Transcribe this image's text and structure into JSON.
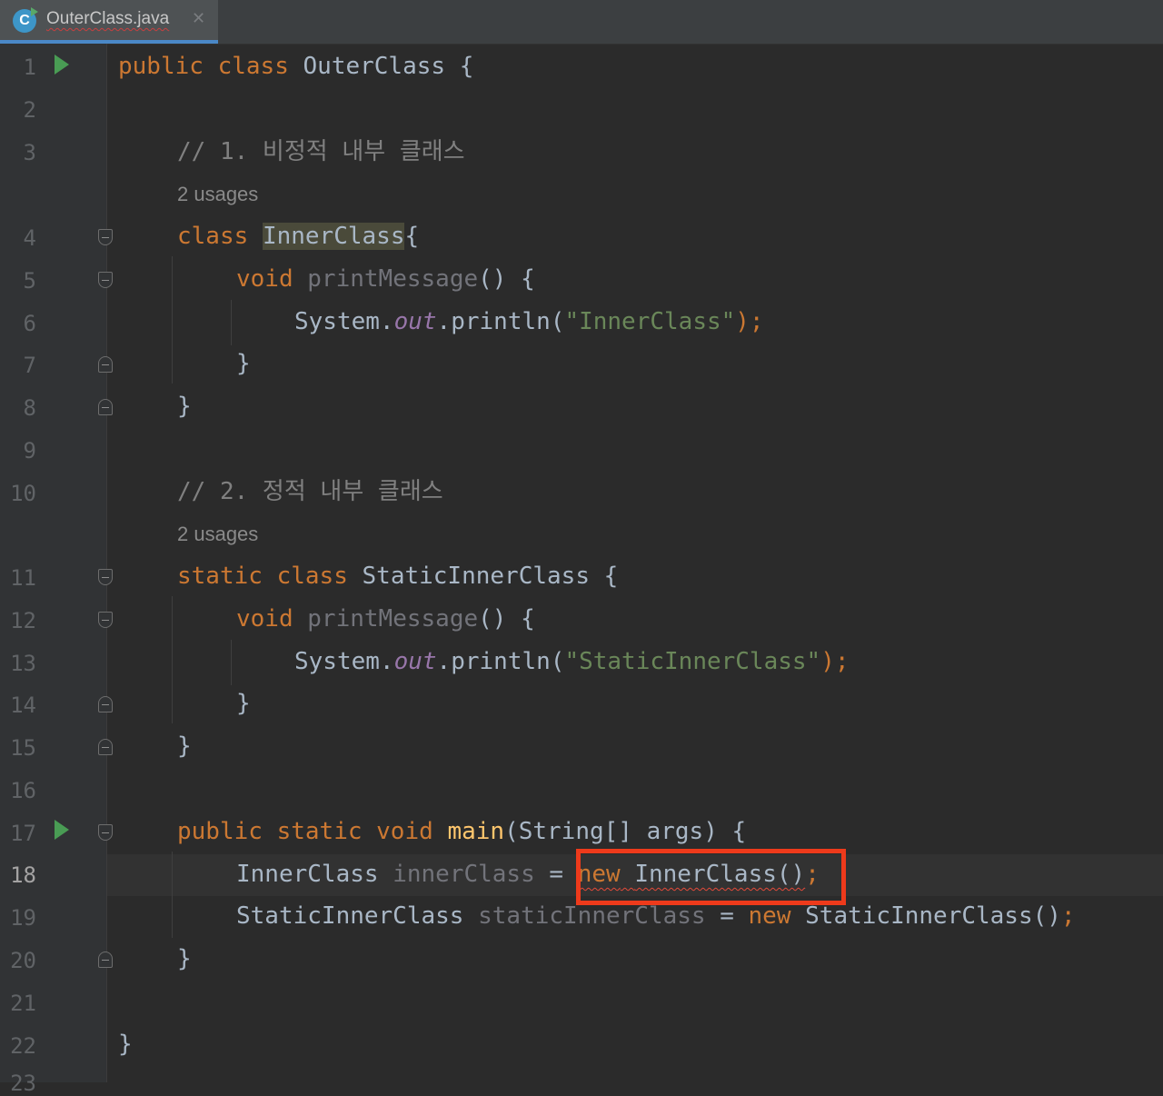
{
  "tab": {
    "file_name": "OuterClass.java",
    "icon_letter": "C",
    "close_glyph": "✕"
  },
  "gutter": {
    "line_numbers": [
      "1",
      "2",
      "3",
      "4",
      "5",
      "6",
      "7",
      "8",
      "9",
      "10",
      "11",
      "12",
      "13",
      "14",
      "15",
      "16",
      "17",
      "18",
      "19",
      "20",
      "21",
      "22",
      "23"
    ],
    "current_line": "18"
  },
  "code": {
    "l1": {
      "kw1": "public",
      "kw2": "class",
      "name": "OuterClass",
      "brace": "{"
    },
    "l3": "// 1. 비정적 내부 클래스",
    "hint1": "2 usages",
    "l4": {
      "kw": "class",
      "name": "InnerClass",
      "brace": "{"
    },
    "l5": {
      "kw": "void",
      "method": "printMessage",
      "rest": "() {"
    },
    "l6": {
      "obj": "System.",
      "field": "out",
      "call": ".println(",
      "str": "\"InnerClass\"",
      "end": ");"
    },
    "l7": "}",
    "l8": "}",
    "l10": "// 2. 정적 내부 클래스",
    "hint2": "2 usages",
    "l11": {
      "kw1": "static",
      "kw2": "class",
      "name": "StaticInnerClass",
      "brace": "{"
    },
    "l12": {
      "kw": "void",
      "method": "printMessage",
      "rest": "() {"
    },
    "l13": {
      "obj": "System.",
      "field": "out",
      "call": ".println(",
      "str": "\"StaticInnerClass\"",
      "end": ");"
    },
    "l14": "}",
    "l15": "}",
    "l17": {
      "kw1": "public",
      "kw2": "static",
      "kw3": "void",
      "method": "main",
      "rest": "(String[] args) {"
    },
    "l18": {
      "type": "InnerClass",
      "var": "innerClass",
      "eq": "=",
      "new": "new",
      "ctor": "InnerClass()",
      "semi": ";"
    },
    "l19": {
      "type": "StaticInnerClass",
      "var": "staticInnerClass",
      "eq": "=",
      "new": "new",
      "ctor": "StaticInnerClass()",
      "semi": ";"
    },
    "l20": "}",
    "l22": "}"
  },
  "colors": {
    "keyword": "#cc7832",
    "comment": "#808080",
    "string": "#6a8759",
    "field": "#9876aa",
    "method_decl": "#ffc66d",
    "highlight_box": "#ee3a1b"
  }
}
